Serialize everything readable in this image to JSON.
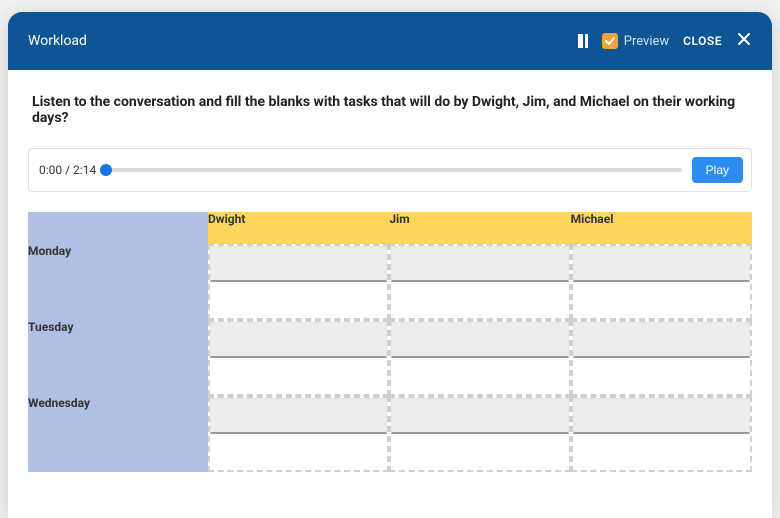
{
  "header": {
    "title": "Workload",
    "preview_label": "Preview",
    "preview_checked": true,
    "close_label": "CLOSE"
  },
  "question": "Listen to the conversation and fill the blanks with tasks that will do by Dwight, Jim, and Michael on their working days?",
  "audio": {
    "current": "0:00",
    "duration": "2:14",
    "play_label": "Play"
  },
  "grid": {
    "columns": [
      "Dwight",
      "Jim",
      "Michael"
    ],
    "rows": [
      "Monday",
      "Tuesday",
      "Wednesday"
    ],
    "cells": {
      "Monday": {
        "Dwight": "",
        "Jim": "",
        "Michael": ""
      },
      "Tuesday": {
        "Dwight": "",
        "Jim": "",
        "Michael": ""
      },
      "Wednesday": {
        "Dwight": "",
        "Jim": "",
        "Michael": ""
      }
    }
  }
}
